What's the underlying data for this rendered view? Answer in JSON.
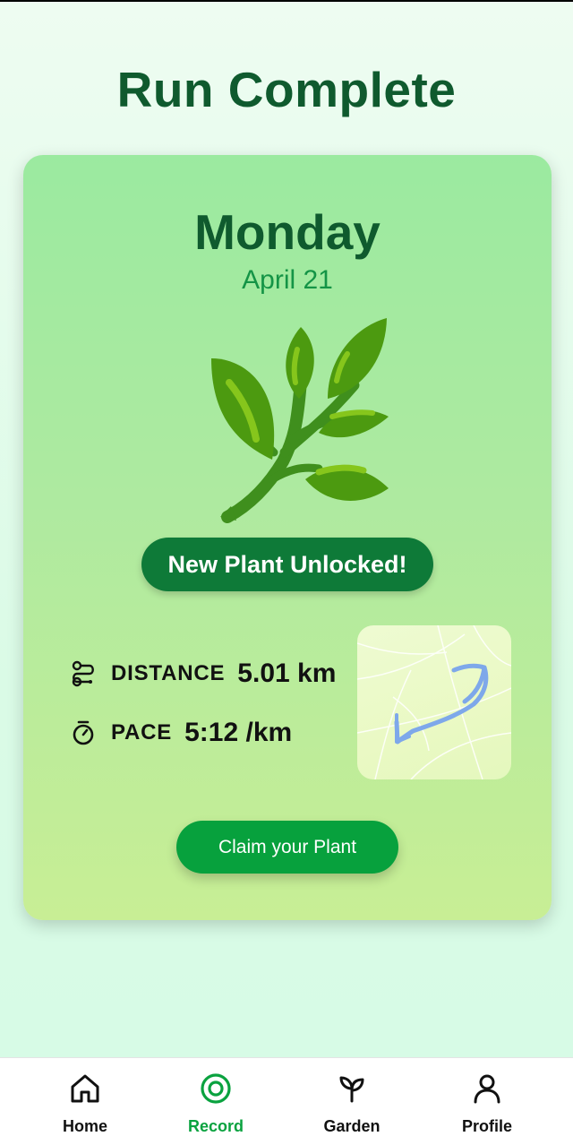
{
  "header": {
    "title": "Run Complete"
  },
  "card": {
    "day": "Monday",
    "date": "April 21",
    "plant_icon": "leafy-branch-icon",
    "badge": "New Plant Unlocked!",
    "stats": {
      "distance": {
        "icon": "route-icon",
        "label": "DISTANCE",
        "value": "5.01 km"
      },
      "pace": {
        "icon": "stopwatch-icon",
        "label": "PACE",
        "value": "5:12 /km"
      }
    },
    "claim_button": "Claim your Plant"
  },
  "nav": {
    "active": "record",
    "items": [
      {
        "id": "home",
        "label": "Home",
        "icon": "home-icon"
      },
      {
        "id": "record",
        "label": "Record",
        "icon": "record-icon"
      },
      {
        "id": "garden",
        "label": "Garden",
        "icon": "sprout-icon"
      },
      {
        "id": "profile",
        "label": "Profile",
        "icon": "user-icon"
      }
    ]
  },
  "colors": {
    "title_green": "#0f5a2e",
    "accent_green": "#07a13d",
    "badge_green": "#0e7a38",
    "route_blue": "#7ea8ea"
  }
}
